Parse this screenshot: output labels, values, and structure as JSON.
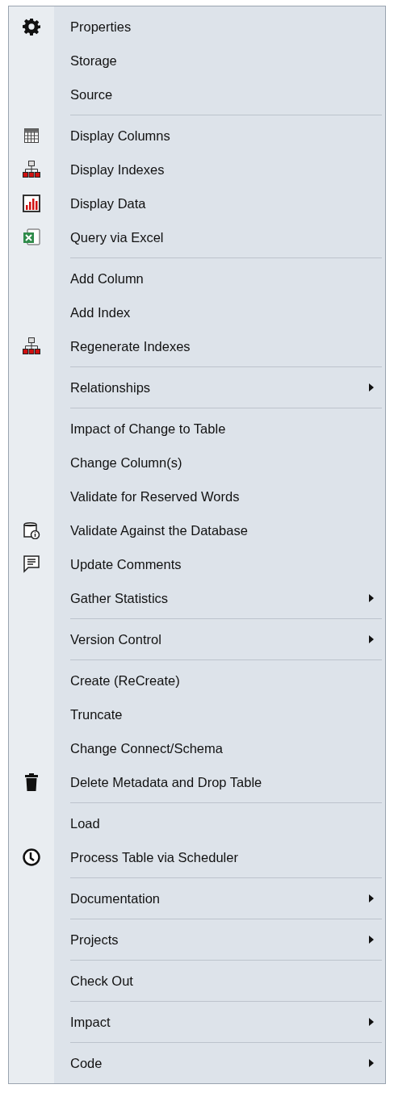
{
  "menu": {
    "groups": [
      {
        "items": [
          {
            "label": "Properties",
            "kind": "gear",
            "submenu": false
          },
          {
            "label": "Storage",
            "submenu": false
          },
          {
            "label": "Source",
            "submenu": false
          }
        ]
      },
      {
        "items": [
          {
            "label": "Display Columns",
            "kind": "grid",
            "submenu": false
          },
          {
            "label": "Display Indexes",
            "kind": "hierarchy",
            "submenu": false
          },
          {
            "label": "Display Data",
            "kind": "chart",
            "submenu": false
          },
          {
            "label": "Query via Excel",
            "kind": "excel",
            "submenu": false
          }
        ]
      },
      {
        "items": [
          {
            "label": "Add Column",
            "submenu": false
          },
          {
            "label": "Add Index",
            "submenu": false
          },
          {
            "label": "Regenerate Indexes",
            "kind": "hierarchy",
            "submenu": false
          }
        ]
      },
      {
        "items": [
          {
            "label": "Relationships",
            "submenu": true
          }
        ]
      },
      {
        "items": [
          {
            "label": "Impact of Change to Table",
            "submenu": false
          },
          {
            "label": "Change Column(s)",
            "submenu": false
          },
          {
            "label": "Validate for Reserved Words",
            "submenu": false
          },
          {
            "label": "Validate Against the Database",
            "kind": "database",
            "submenu": false
          },
          {
            "label": "Update Comments",
            "kind": "comment",
            "submenu": false
          },
          {
            "label": "Gather Statistics",
            "submenu": true
          }
        ]
      },
      {
        "items": [
          {
            "label": "Version Control",
            "submenu": true
          }
        ]
      },
      {
        "items": [
          {
            "label": "Create (ReCreate)",
            "submenu": false
          },
          {
            "label": "Truncate",
            "submenu": false
          },
          {
            "label": "Change Connect/Schema",
            "submenu": false
          },
          {
            "label": "Delete Metadata and Drop Table",
            "kind": "trash",
            "submenu": false
          }
        ]
      },
      {
        "items": [
          {
            "label": "Load",
            "submenu": false
          },
          {
            "label": "Process Table via Scheduler",
            "kind": "clock",
            "submenu": false
          }
        ]
      },
      {
        "items": [
          {
            "label": "Documentation",
            "submenu": true
          }
        ]
      },
      {
        "items": [
          {
            "label": "Projects",
            "submenu": true
          }
        ]
      },
      {
        "items": [
          {
            "label": "Check Out",
            "submenu": false
          }
        ]
      },
      {
        "items": [
          {
            "label": "Impact",
            "submenu": true
          }
        ]
      },
      {
        "items": [
          {
            "label": "Code",
            "submenu": true
          }
        ]
      }
    ]
  }
}
